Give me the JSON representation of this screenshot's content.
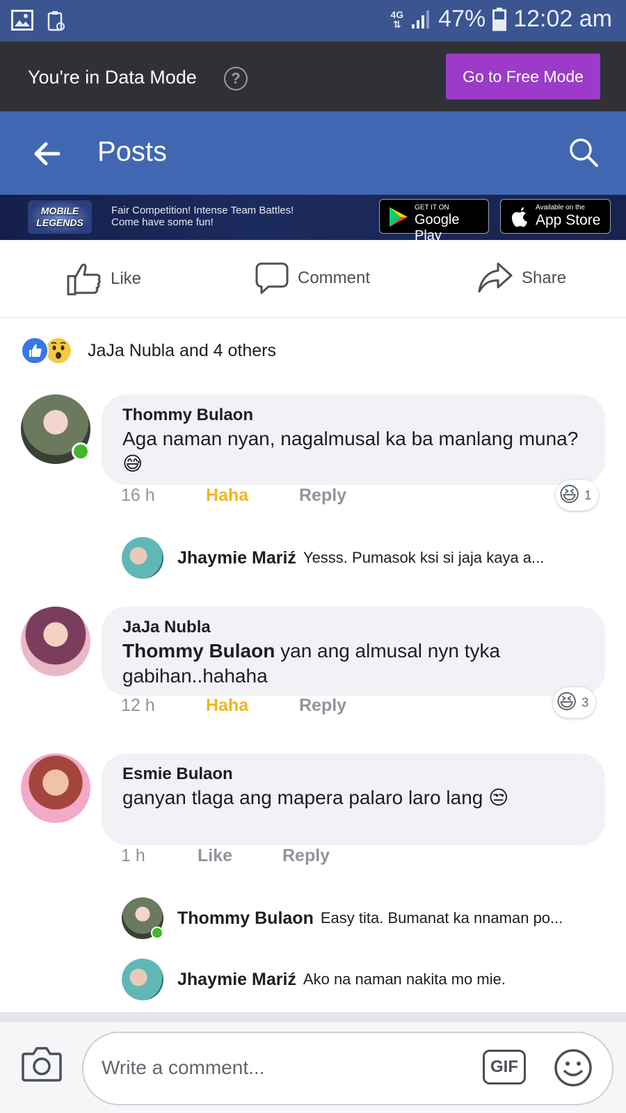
{
  "status_bar": {
    "network": "4G",
    "battery": "47%",
    "time": "12:02",
    "ampm": "am"
  },
  "data_mode": {
    "text": "You're in Data Mode",
    "help": "?",
    "button": "Go to Free Mode"
  },
  "header": {
    "title": "Posts"
  },
  "ad": {
    "logo_line1": "MOBILE",
    "logo_line2": "LEGENDS",
    "line1": "Fair Competition! Intense Team Battles!",
    "line2": "Come have some fun!",
    "google_small": "GET IT ON",
    "google_big": "Google Play",
    "apple_small": "Available on the",
    "apple_big": "App Store"
  },
  "actions": {
    "like": "Like",
    "comment": "Comment",
    "share": "Share"
  },
  "reactions_summary": "JaJa Nubla and 4 others",
  "comments": [
    {
      "name": "Thommy Bulaon",
      "text": "Aga naman nyan, nagalmusal ka ba manlang muna? 😅",
      "time": "16 h",
      "reaction_label": "Haha",
      "reply_label": "Reply",
      "reaction_count": "1"
    },
    {
      "name": "JaJa Nubla",
      "text": "Thommy Bulaon yan ang almusal nyn tyka gabihan..hahaha",
      "mention": "Thommy Bulaon",
      "rest": " yan ang almusal nyn tyka gabihan..hahaha",
      "time": "12 h",
      "reaction_label": "Haha",
      "reply_label": "Reply",
      "reaction_count": "3"
    },
    {
      "name": "Esmie Bulaon",
      "text": "ganyan tlaga ang mapera   palaro laro lang 😒",
      "time": "1 h",
      "reaction_label": "Like",
      "reply_label": "Reply"
    }
  ],
  "replies": [
    {
      "name": "Jhaymie Mariź",
      "text": "Yesss. Pumasok ksi si jaja kaya a..."
    },
    {
      "name": "Thommy Bulaon",
      "text": "Easy tita. Bumanat ka nnaman po..."
    },
    {
      "name": "Jhaymie Mariź",
      "text": "Ako na naman nakita mo mie."
    }
  ],
  "composer": {
    "placeholder": "Write a comment...",
    "gif": "GIF"
  },
  "colors": {
    "status_bar": "#3b5591",
    "header": "#4267b2",
    "data_bar": "#2f3136",
    "free_mode_button": "#9b3bc8",
    "haha": "#f2b619",
    "online": "#42b72a"
  }
}
